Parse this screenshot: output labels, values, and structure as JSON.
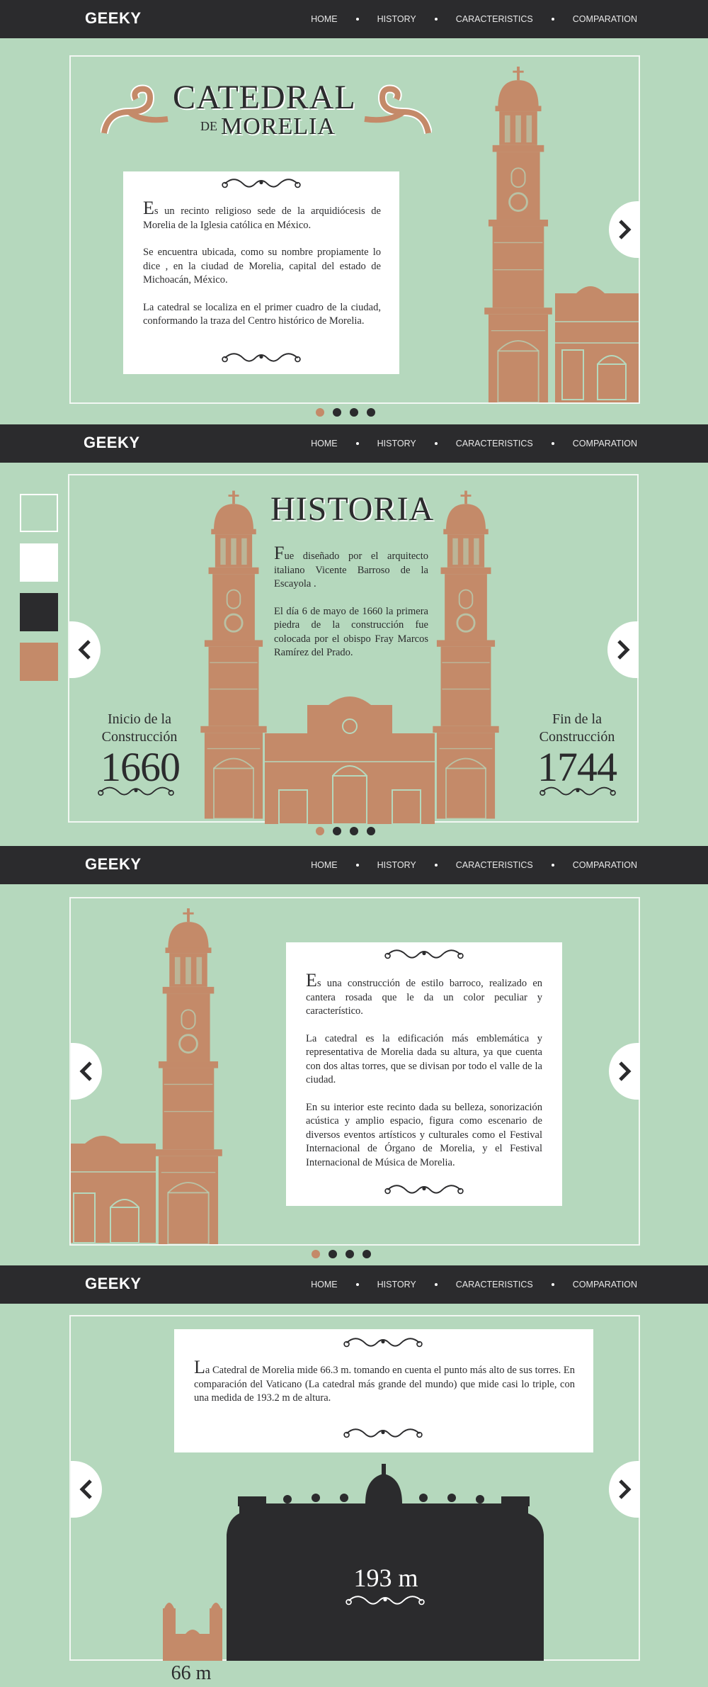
{
  "brand": {
    "logo": "GEEKY"
  },
  "nav": [
    {
      "label": "HOME"
    },
    {
      "label": "HISTORY"
    },
    {
      "label": "CARACTERISTICS"
    },
    {
      "label": "COMPARATION"
    }
  ],
  "colors": {
    "background": "#b5d8bd",
    "dark": "#2b2b2d",
    "terracotta": "#c48a69",
    "white": "#ffffff"
  },
  "slide1": {
    "title_main": "CATEDRAL",
    "title_de": "DE",
    "title_sub": "MORELIA",
    "drop_cap": "E",
    "p1": "s un recinto religioso sede de la arquidiócesis de Morelia de la Iglesia católica en México.",
    "p2": "Se encuentra ubicada, como su nombre propiamente lo dice , en la ciudad de Morelia, capital del estado de Michoacán, México.",
    "p3": "La catedral se localiza en el primer cuadro de la ciudad, conformando la traza del Centro histórico de Morelia."
  },
  "slide2": {
    "title": "HISTORIA",
    "drop_cap": "F",
    "p1": "ue diseñado por el arquitecto italiano Vicente Barroso de la Escayola .",
    "p2": "El día 6 de mayo de 1660 la primera piedra de la construcción fue colocada por el obispo Fray Marcos Ramírez del Prado.",
    "start_label_1": "Inicio de la",
    "start_label_2": "Construcción",
    "start_year": "1660",
    "end_label_1": "Fin de la",
    "end_label_2": "Construcción",
    "end_year": "1744",
    "swatches": [
      "#b5d8bd",
      "#ffffff",
      "#2b2b2d",
      "#c48a69"
    ]
  },
  "slide3": {
    "drop_cap": "E",
    "p1": "s una construcción de estilo barroco, realizado en cantera rosada que le da un color peculiar y característico.",
    "p2": "La catedral es la edificación más emblemática y representativa de Morelia dada su altura, ya que cuenta con dos altas torres, que se divisan por todo el valle de la ciudad.",
    "p3": "En su interior este recinto dada su belleza, sonorización acústica y amplio espacio, figura como escenario de diversos eventos artísticos y culturales como el Festival Internacional de Órgano de Morelia, y el Festival Internacional de Música de Morelia."
  },
  "slide4": {
    "drop_cap": "L",
    "p1": "a Catedral de Morelia mide 66.3 m. tomando en cuenta el punto más alto de sus torres. En comparación del Vaticano (La catedral más grande del mundo) que mide casi lo triple, con una medida de 193.2 m de altura.",
    "vatican_height": "193 m",
    "morelia_height": "66 m"
  },
  "carousel": {
    "active_index": 0,
    "count": 4
  }
}
